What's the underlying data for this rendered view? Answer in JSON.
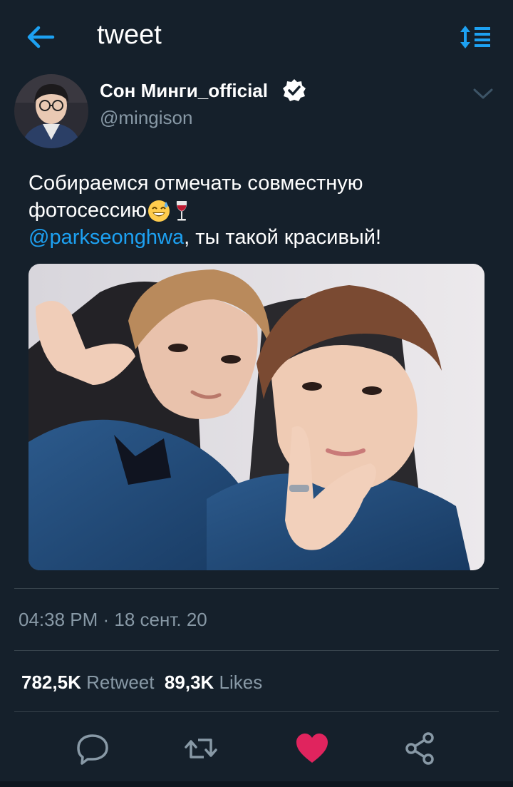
{
  "header": {
    "title": "tweet",
    "back_icon": "arrow-left-icon",
    "sort_icon": "sort-lines-icon"
  },
  "author": {
    "display_name": "Сон Минги_official",
    "handle": "@mingison",
    "verified": true,
    "avatar_icon": "avatar-photo",
    "more_icon": "chevron-down-icon"
  },
  "tweet": {
    "line1": "Собираемся отмечать совместную",
    "line2": "фотосессию",
    "emoji1": "sweat-smile-emoji",
    "emoji2": "wine-glass-emoji",
    "mention": "@parkseonghwa",
    "line3_rest": ", ты такой красивый!"
  },
  "media": {
    "description_icon": "selfie-photo"
  },
  "meta": {
    "timestamp": "04:38 PM · 18 сент. 20"
  },
  "stats": {
    "retweets_count": "782,5K",
    "retweets_label": "Retweet",
    "likes_count": "89,3K",
    "likes_label": "Likes"
  },
  "actions": {
    "reply_icon": "reply-icon",
    "retweet_icon": "retweet-icon",
    "like_icon": "heart-icon",
    "share_icon": "share-icon",
    "like_color": "#e0245e"
  },
  "colors": {
    "background": "#15202b",
    "accent": "#1da1f2",
    "secondary_text": "#8899a6",
    "divider": "#38444d"
  }
}
